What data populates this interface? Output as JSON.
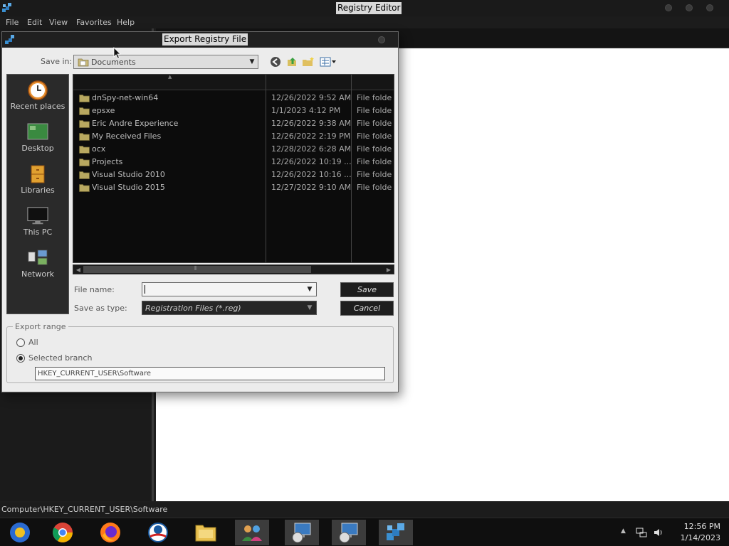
{
  "window": {
    "title": "Registry Editor",
    "menu": [
      "File",
      "Edit",
      "View",
      "Favorites",
      "Help"
    ],
    "status_path": "Computer\\HKEY_CURRENT_USER\\Software"
  },
  "dialog": {
    "title": "Export Registry File",
    "save_in_label": "Save in:",
    "save_in_value": "Documents",
    "places": [
      "Recent places",
      "Desktop",
      "Libraries",
      "This PC",
      "Network"
    ],
    "files": [
      {
        "name": "dnSpy-net-win64",
        "date": "12/26/2022 9:52 AM",
        "type": "File folde"
      },
      {
        "name": "epsxe",
        "date": "1/1/2023 4:12 PM",
        "type": "File folde"
      },
      {
        "name": "Eric Andre Experience",
        "date": "12/26/2022 9:38 AM",
        "type": "File folde"
      },
      {
        "name": "My Received Files",
        "date": "12/26/2022 2:19 PM",
        "type": "File folde"
      },
      {
        "name": "ocx",
        "date": "12/28/2022 6:28 AM",
        "type": "File folde"
      },
      {
        "name": "Projects",
        "date": "12/26/2022 10:19 ...",
        "type": "File folde"
      },
      {
        "name": "Visual Studio 2010",
        "date": "12/26/2022 10:16 ...",
        "type": "File folde"
      },
      {
        "name": "Visual Studio 2015",
        "date": "12/27/2022 9:10 AM",
        "type": "File folde"
      }
    ],
    "file_name_label": "File name:",
    "file_name_value": "",
    "save_as_type_label": "Save as type:",
    "save_as_type_value": "Registration Files (*.reg)",
    "save_button": "Save",
    "cancel_button": "Cancel",
    "export_range": {
      "legend": "Export range",
      "all_label": "All",
      "selected_label": "Selected branch",
      "selected": "Selected branch",
      "branch_value": "HKEY_CURRENT_USER\\Software"
    }
  },
  "taskbar": {
    "apps": [
      "file-explorer-blue",
      "chrome",
      "firefox",
      "obama-logo",
      "file-explorer",
      "network-users",
      "remote-desktop-1",
      "remote-desktop-2",
      "registry-editor"
    ],
    "time": "12:56 PM",
    "date": "1/14/2023"
  }
}
